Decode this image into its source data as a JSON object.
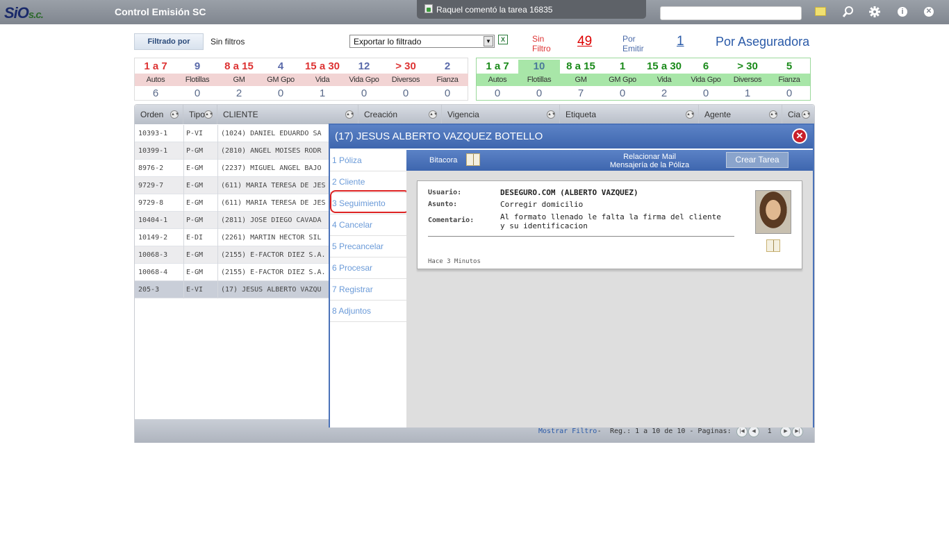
{
  "app": {
    "logo_main": "SiO",
    "logo_sub": "s.c.",
    "title": "Control Emisión SC",
    "notification": "Raquel comentó la tarea 16835",
    "search_value": ""
  },
  "toolbar": {
    "filtrado_label": "Filtrado por",
    "filters_value": "Sin filtros",
    "export_selected": "Exportar lo filtrado",
    "sinfiltro_label_1": "Sin",
    "sinfiltro_label_2": "Filtro",
    "sinfiltro_count": "49",
    "poremitir_label_1": "Por",
    "poremitir_label_2": "Emitir",
    "poremitir_count": "1",
    "view_title": "Por Aseguradora"
  },
  "stats_left": {
    "cats": [
      "1 a 7",
      "9",
      "8 a 15",
      "4",
      "15 a 30",
      "12",
      "> 30",
      "2"
    ],
    "labels": [
      "Autos",
      "Flotillas",
      "GM",
      "GM Gpo",
      "Vida",
      "Vida Gpo",
      "Diversos",
      "Fianza"
    ],
    "values": [
      "6",
      "0",
      "2",
      "0",
      "1",
      "0",
      "0",
      "0"
    ]
  },
  "stats_right": {
    "cats": [
      "1 a 7",
      "10",
      "8 a 15",
      "1",
      "15 a 30",
      "6",
      "> 30",
      "5"
    ],
    "labels": [
      "Autos",
      "Flotillas",
      "GM",
      "GM Gpo",
      "Vida",
      "Vida Gpo",
      "Diversos",
      "Fianza"
    ],
    "values": [
      "0",
      "0",
      "7",
      "0",
      "2",
      "0",
      "1",
      "0"
    ]
  },
  "grid": {
    "headers": [
      "Orden",
      "Tipo",
      "CLIENTE",
      "Creación",
      "Vigencia",
      "Etiqueta",
      "Agente",
      "Cia"
    ],
    "rows": [
      {
        "orden": "10393-1",
        "tipo": "P-VI",
        "cliente": "(1024) DANIEL EDUARDO SA"
      },
      {
        "orden": "10399-1",
        "tipo": "P-GM",
        "cliente": "(2810) ANGEL MOISES RODR"
      },
      {
        "orden": "8976-2",
        "tipo": "E-GM",
        "cliente": "(2237) MIGUEL ANGEL BAJO"
      },
      {
        "orden": "9729-7",
        "tipo": "E-GM",
        "cliente": "(611) MARIA TERESA DE JES"
      },
      {
        "orden": "9729-8",
        "tipo": "E-GM",
        "cliente": "(611) MARIA TERESA DE JES"
      },
      {
        "orden": "10404-1",
        "tipo": "P-GM",
        "cliente": "(2811) JOSE DIEGO CAVADA"
      },
      {
        "orden": "10149-2",
        "tipo": "E-DI",
        "cliente": "(2261) MARTIN HECTOR SIL"
      },
      {
        "orden": "10068-3",
        "tipo": "E-GM",
        "cliente": "(2155) E-FACTOR DIEZ S.A."
      },
      {
        "orden": "10068-4",
        "tipo": "E-GM",
        "cliente": "(2155) E-FACTOR DIEZ S.A."
      },
      {
        "orden": "205-3",
        "tipo": "E-VI",
        "cliente": "(17) JESUS ALBERTO VAZQU"
      }
    ],
    "footer": {
      "mostrar": "Mostrar Filtro",
      "sep": "-",
      "regs": "Reg.: 1 a 10 de 10 - Paginas:",
      "page": "1"
    }
  },
  "modal": {
    "title": "(17) JESUS ALBERTO VAZQUEZ BOTELLO",
    "close_glyph": "✕",
    "nav": [
      "1 Póliza",
      "2 Cliente",
      "3 Seguimiento",
      "4 Cancelar",
      "5 Precancelar",
      "6 Procesar",
      "7 Registrar",
      "8 Adjuntos"
    ],
    "bitacora": "Bitacora",
    "relacionar_1": "Relacionar Mail",
    "relacionar_2": "Mensajería de la Póliza",
    "crear_tarea": "Crear Tarea",
    "card": {
      "usuario_label": "Usuario:",
      "usuario": "DESEGURO.COM (ALBERTO VAZQUEZ)",
      "asunto_label": "Asunto:",
      "asunto": "Corregir domicilio",
      "comentario_label": "Comentario:",
      "comentario": "Al formato llenado le falta la firma del cliente y su identificacion",
      "hace": "Hace 3 Minutos"
    }
  },
  "icons": [
    "note-icon",
    "search-icon",
    "gear-icon",
    "info-icon",
    "close-icon",
    "excel-icon",
    "book-icon",
    "avatar"
  ],
  "colors": {
    "accent": "#4a72b8",
    "red": "#d33",
    "green": "#1a8a1a",
    "link": "#2a5aa8"
  }
}
